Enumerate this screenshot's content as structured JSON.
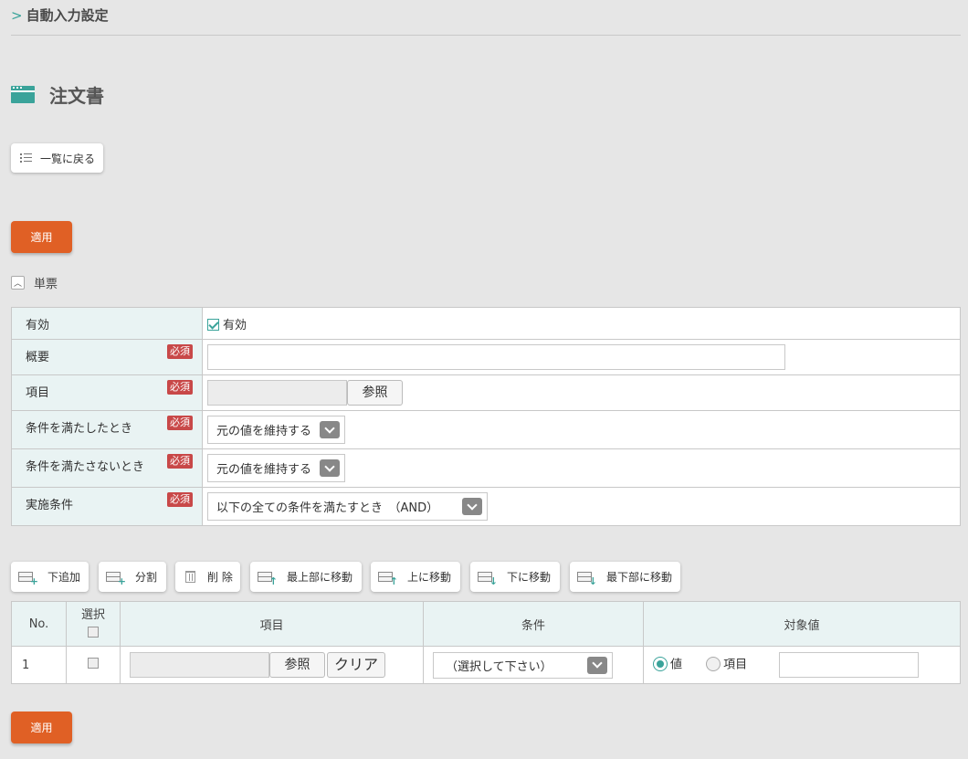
{
  "breadcrumb": {
    "label": "自動入力設定"
  },
  "page": {
    "title": "注文書"
  },
  "back_button": {
    "label": "一覧に戻る"
  },
  "apply_button": {
    "label": "適用"
  },
  "section": {
    "label": "単票"
  },
  "form": {
    "required_label": "必須",
    "rows": [
      {
        "label": "有効",
        "checkbox_label": "有効",
        "checked": true
      },
      {
        "label": "概要",
        "value": ""
      },
      {
        "label": "項目",
        "value": "",
        "browse_label": "参照"
      },
      {
        "label": "条件を満たしたとき",
        "selected": "元の値を維持する"
      },
      {
        "label": "条件を満たさないとき",
        "selected": "元の値を維持する"
      },
      {
        "label": "実施条件",
        "selected": "以下の全ての条件を満たすとき　（AND）"
      }
    ]
  },
  "toolbar": [
    {
      "label": "下追加",
      "icon": "add-row-below-icon"
    },
    {
      "label": "分割",
      "icon": "split-row-icon"
    },
    {
      "label": "削 除",
      "icon": "trash-icon"
    },
    {
      "label": "最上部に移動",
      "icon": "move-top-icon"
    },
    {
      "label": "上に移動",
      "icon": "move-up-icon"
    },
    {
      "label": "下に移動",
      "icon": "move-down-icon"
    },
    {
      "label": "最下部に移動",
      "icon": "move-bottom-icon"
    }
  ],
  "grid": {
    "headers": {
      "no": "No.",
      "select": "選択",
      "item": "項目",
      "condition": "条件",
      "target": "対象値"
    },
    "rows": [
      {
        "no": "1",
        "item_value": "",
        "browse_label": "参照",
        "clear_label": "クリア",
        "condition": "（選択して下さい）",
        "target_options": [
          "値",
          "項目"
        ],
        "target_selected": "値",
        "target_value": ""
      }
    ]
  },
  "colors": {
    "accent": "#3aa39a",
    "apply": "#e06025",
    "required": "#c84848"
  }
}
